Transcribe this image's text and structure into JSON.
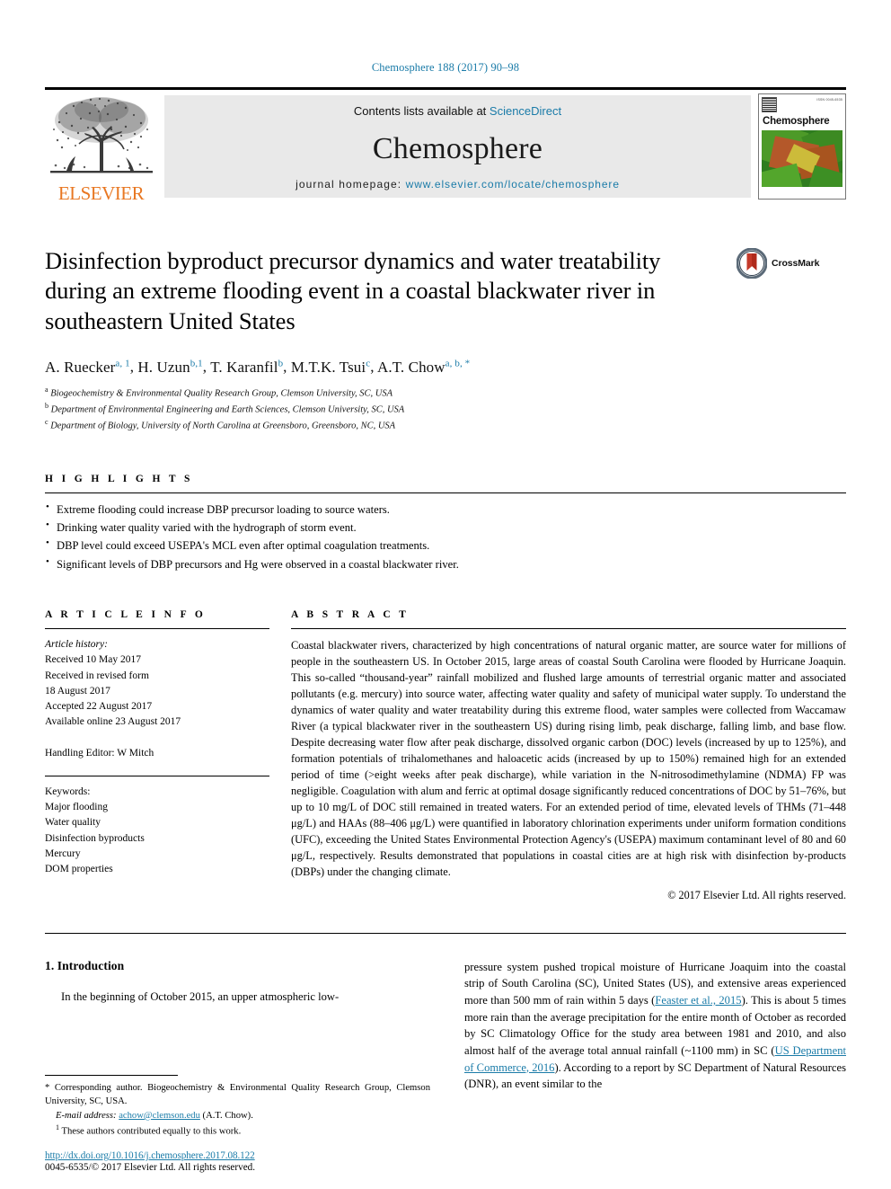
{
  "running_head": "Chemosphere 188 (2017) 90–98",
  "masthead": {
    "publisher_name": "ELSEVIER",
    "contents_prefix": "Contents lists available at ",
    "contents_link": "ScienceDirect",
    "journal_name": "Chemosphere",
    "homepage_prefix": "journal homepage: ",
    "homepage_url": "www.elsevier.com/locate/chemosphere",
    "cover_title": "Chemosphere",
    "cover_tiny_text": "ISSN 0045-6535"
  },
  "crossmark": {
    "label": "CrossMark"
  },
  "article": {
    "title": "Disinfection byproduct precursor dynamics and water treatability during an extreme flooding event in a coastal blackwater river in southeastern United States",
    "authors_plain": "A. Ruecker a, 1, H. Uzun b,1, T. Karanfil b, M.T.K. Tsui c, A.T. Chow a, b, *",
    "authors": [
      {
        "name": "A. Ruecker",
        "marks": "a, 1"
      },
      {
        "name": "H. Uzun",
        "marks": "b,1"
      },
      {
        "name": "T. Karanfil",
        "marks": "b"
      },
      {
        "name": "M.T.K. Tsui",
        "marks": "c"
      },
      {
        "name": "A.T. Chow",
        "marks": "a, b, *"
      }
    ],
    "affiliations": [
      {
        "mark": "a",
        "text": "Biogeochemistry & Environmental Quality Research Group, Clemson University, SC, USA"
      },
      {
        "mark": "b",
        "text": "Department of Environmental Engineering and Earth Sciences, Clemson University, SC, USA"
      },
      {
        "mark": "c",
        "text": "Department of Biology, University of North Carolina at Greensboro, Greensboro, NC, USA"
      }
    ]
  },
  "highlights": {
    "heading": "H I G H L I G H T S",
    "items": [
      "Extreme flooding could increase DBP precursor loading to source waters.",
      "Drinking water quality varied with the hydrograph of storm event.",
      "DBP level could exceed USEPA's MCL even after optimal coagulation treatments.",
      "Significant levels of DBP precursors and Hg were observed in a coastal blackwater river."
    ]
  },
  "article_info": {
    "heading": "A R T I C L E  I N F O",
    "history_label": "Article history:",
    "history": [
      "Received 10 May 2017",
      "Received in revised form",
      "18 August 2017",
      "Accepted 22 August 2017",
      "Available online 23 August 2017"
    ],
    "handling_editor": "Handling Editor: W Mitch",
    "keywords_label": "Keywords:",
    "keywords": [
      "Major flooding",
      "Water quality",
      "Disinfection byproducts",
      "Mercury",
      "DOM properties"
    ]
  },
  "abstract": {
    "heading": "A B S T R A C T",
    "text": "Coastal blackwater rivers, characterized by high concentrations of natural organic matter, are source water for millions of people in the southeastern US. In October 2015, large areas of coastal South Carolina were flooded by Hurricane Joaquin. This so-called “thousand-year” rainfall mobilized and flushed large amounts of terrestrial organic matter and associated pollutants (e.g. mercury) into source water, affecting water quality and safety of municipal water supply. To understand the dynamics of water quality and water treatability during this extreme flood, water samples were collected from Waccamaw River (a typical blackwater river in the southeastern US) during rising limb, peak discharge, falling limb, and base flow. Despite decreasing water flow after peak discharge, dissolved organic carbon (DOC) levels (increased by up to 125%), and formation potentials of trihalomethanes and haloacetic acids (increased by up to 150%) remained high for an extended period of time (>eight weeks after peak discharge), while variation in the N-nitrosodimethylamine (NDMA) FP was negligible. Coagulation with alum and ferric at optimal dosage significantly reduced concentrations of DOC by 51–76%, but up to 10 mg/L of DOC still remained in treated waters. For an extended period of time, elevated levels of THMs (71–448 μg/L) and HAAs (88–406 μg/L) were quantified in laboratory chlorination experiments under uniform formation conditions (UFC), exceeding the United States Environmental Protection Agency's (USEPA) maximum contaminant level of 80 and 60 μg/L, respectively. Results demonstrated that populations in coastal cities are at high risk with disinfection by-products (DBPs) under the changing climate.",
    "copyright": "© 2017 Elsevier Ltd. All rights reserved."
  },
  "intro": {
    "heading": "1. Introduction",
    "col1_p1": "In the beginning of October 2015, an upper atmospheric low-",
    "col2_p1_a": "pressure system pushed tropical moisture of Hurricane Joaquim into the coastal strip of South Carolina (SC), United States (US), and extensive areas experienced more than 500 mm of rain within 5 days (",
    "col2_cite1": "Feaster et al., 2015",
    "col2_p1_b": "). This is about 5 times more rain than the average precipitation for the entire month of October as recorded by SC Climatology Office for the study area between 1981 and 2010, and also almost half of the average total annual rainfall (~1100 mm) in SC (",
    "col2_cite2": "US Department of Commerce, 2016",
    "col2_p1_c": "). According to a report by SC Department of Natural Resources (DNR), an event similar to the"
  },
  "footnotes": {
    "corresponding": "* Corresponding author. Biogeochemistry & Environmental Quality Research Group, Clemson University, SC, USA.",
    "email_label": "E-mail address:",
    "email": "achow@clemson.edu",
    "email_suffix": "(A.T. Chow).",
    "equal_mark": "1",
    "equal_text": "These authors contributed equally to this work."
  },
  "doi": {
    "url": "http://dx.doi.org/10.1016/j.chemosphere.2017.08.122",
    "issn_line": "0045-6535/© 2017 Elsevier Ltd. All rights reserved."
  },
  "colors": {
    "link": "#1a7ba8",
    "elsevier_orange": "#e87722",
    "masthead_gray": "#e9e9e9"
  }
}
